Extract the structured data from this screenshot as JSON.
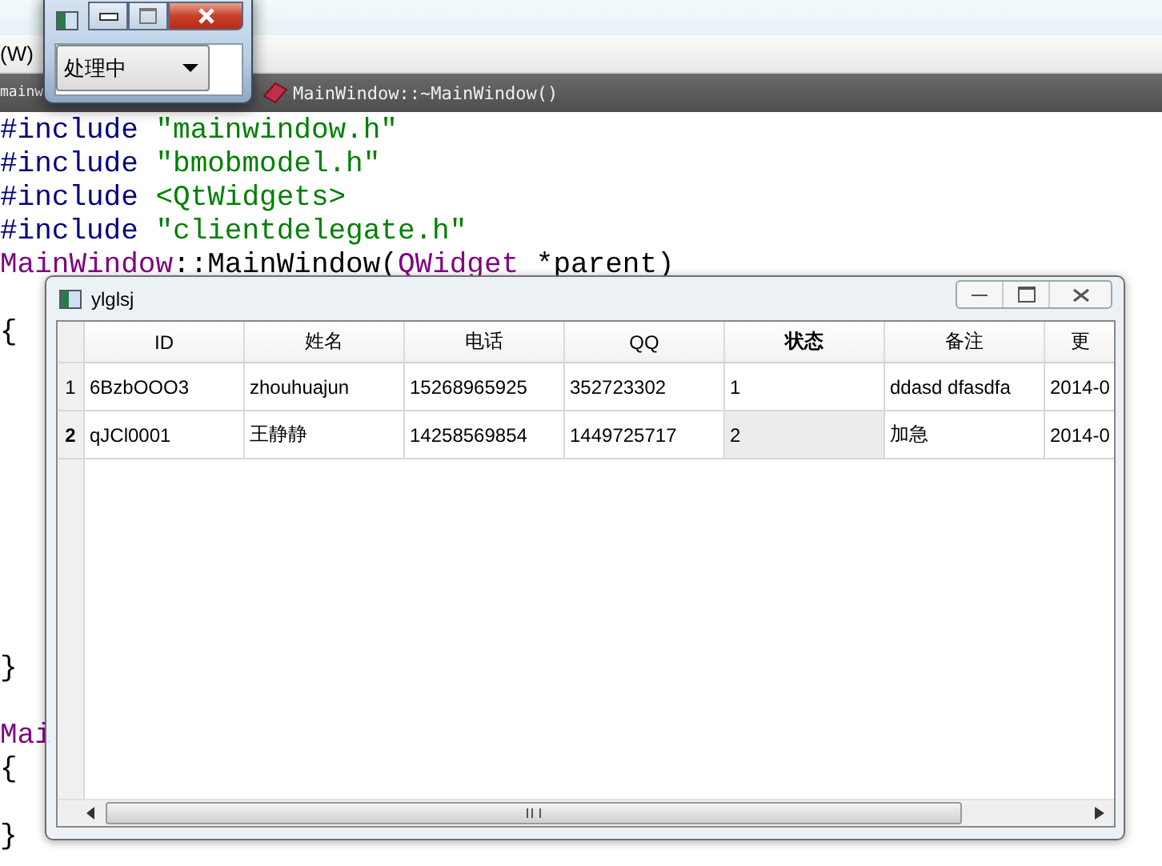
{
  "ide": {
    "menu_item": "(W)",
    "file_tab": "mainw",
    "function_crumb": "MainWindow::~MainWindow()",
    "code_lines": [
      {
        "kind": "code",
        "segments": [
          {
            "text": "#include",
            "kind": "directive"
          },
          {
            "text": " \"mainwindow.h\"",
            "kind": "string"
          }
        ]
      },
      {
        "kind": "code",
        "segments": [
          {
            "text": "#include",
            "kind": "directive"
          },
          {
            "text": " \"bmobmodel.h\"",
            "kind": "string"
          }
        ]
      },
      {
        "kind": "code",
        "segments": [
          {
            "text": "#include",
            "kind": "directive"
          },
          {
            "text": " <QtWidgets>",
            "kind": "string"
          }
        ]
      },
      {
        "kind": "code",
        "segments": [
          {
            "text": "#include",
            "kind": "directive"
          },
          {
            "text": " \"clientdelegate.h\"",
            "kind": "string"
          }
        ]
      },
      {
        "kind": "code",
        "segments": [
          {
            "text": "MainWindow",
            "kind": "type"
          },
          {
            "text": "::MainWindow(",
            "kind": "plain"
          },
          {
            "text": "QWidget",
            "kind": "type"
          },
          {
            "text": " *parent)",
            "kind": "plain"
          }
        ]
      },
      {
        "kind": "blank"
      },
      {
        "kind": "code",
        "segments": [
          {
            "text": "{",
            "kind": "plain"
          }
        ]
      },
      {
        "kind": "blank"
      },
      {
        "kind": "blank"
      },
      {
        "kind": "blank"
      },
      {
        "kind": "blank"
      },
      {
        "kind": "blank"
      },
      {
        "kind": "blank"
      },
      {
        "kind": "blank"
      },
      {
        "kind": "blank"
      },
      {
        "kind": "blank"
      },
      {
        "kind": "code",
        "segments": [
          {
            "text": "}",
            "kind": "plain"
          }
        ]
      },
      {
        "kind": "blank"
      },
      {
        "kind": "code",
        "segments": [
          {
            "text": "Mai",
            "kind": "type"
          }
        ]
      },
      {
        "kind": "code",
        "segments": [
          {
            "text": "{",
            "kind": "plain"
          }
        ]
      },
      {
        "kind": "blank"
      },
      {
        "kind": "code",
        "segments": [
          {
            "text": "}",
            "kind": "plain"
          }
        ]
      }
    ]
  },
  "progress_window": {
    "status_combo": {
      "value": "处理中"
    }
  },
  "table_window": {
    "title": "ylglsj",
    "columns": [
      {
        "label": "ID",
        "selected": false
      },
      {
        "label": "姓名",
        "selected": false
      },
      {
        "label": "电话",
        "selected": false
      },
      {
        "label": "QQ",
        "selected": false
      },
      {
        "label": "状态",
        "selected": true
      },
      {
        "label": "备注",
        "selected": false
      },
      {
        "label": "更",
        "selected": false
      }
    ],
    "rows": [
      {
        "header": "1",
        "selected": false,
        "cells": [
          "6BzbOOO3",
          "zhouhuajun",
          "15268965925",
          "352723302",
          "1",
          "ddasd dfasdfa",
          "2014-0"
        ]
      },
      {
        "header": "2",
        "selected": true,
        "cells": [
          "qJCl0001",
          "王静静",
          "14258569854",
          "1449725717",
          "2",
          "加急",
          "2014-0"
        ]
      }
    ]
  }
}
